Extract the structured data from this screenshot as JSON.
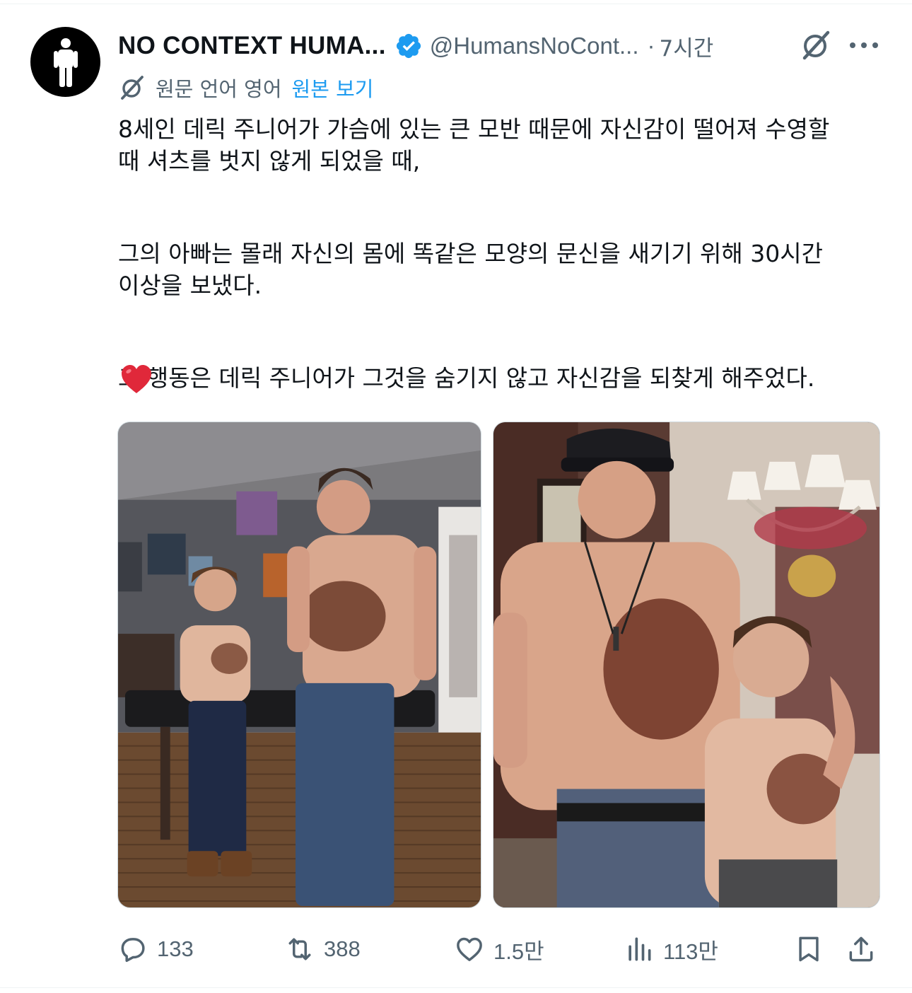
{
  "author": {
    "display_name": "NO CONTEXT HUMA...",
    "handle": "@HumansNoCont...",
    "separator": "·",
    "time": "7시간",
    "verified": true
  },
  "translation": {
    "original_language": "원문 언어 영어",
    "show_original": "원본 보기"
  },
  "tweet": {
    "lines": [
      "8세인 데릭 주니어가 가슴에 있는 큰 모반 때문에 자신감이 떨어져 수영할",
      "때 셔츠를 벗지 않게 되었을 때,",
      "그의 아빠는 몰래 자신의 몸에 똑같은 모양의 문신을 새기기 위해 30시간",
      "이상을 보냈다.",
      "그 행동은 데릭 주니어가 그것을 숨기지 않고 자신감을 되찾게 해주었다."
    ],
    "emoji": "heart-emoji"
  },
  "media": {
    "photos": [
      {
        "icon": "photo-tattoo-shop"
      },
      {
        "icon": "photo-living-room"
      }
    ]
  },
  "actions": {
    "replies": "133",
    "reposts": "388",
    "likes": "1.5만",
    "views": "113만"
  },
  "colors": {
    "text": "#0f1419",
    "secondary": "#536471",
    "link": "#1d9bf0",
    "verified": "#1d9bf0"
  }
}
